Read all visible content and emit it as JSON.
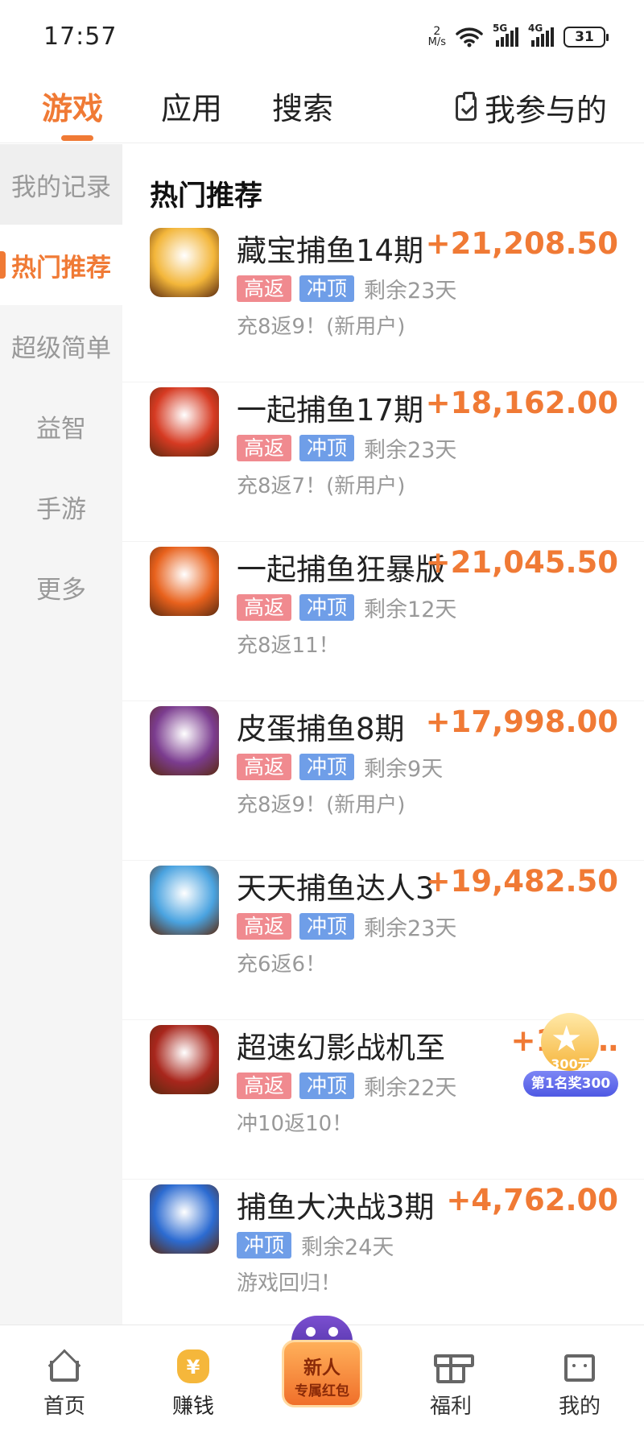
{
  "status_bar": {
    "time": "17:57",
    "net_speed_value": "2",
    "net_speed_unit": "M/s",
    "sim1": "5G",
    "sim2": "4G",
    "battery": "31"
  },
  "top_tabs": {
    "games": "游戏",
    "apps": "应用",
    "search": "搜索",
    "mine": "我参与的"
  },
  "sidebar": {
    "items": [
      {
        "label": "我的记录"
      },
      {
        "label": "热门推荐"
      },
      {
        "label": "超级简单"
      },
      {
        "label": "益智"
      },
      {
        "label": "手游"
      },
      {
        "label": "更多"
      }
    ],
    "active_index": 1
  },
  "main": {
    "section_title": "热门推荐",
    "games": [
      {
        "name": "藏宝捕鱼14期",
        "amount": "+21,208.50",
        "tag_high": "高返",
        "tag_top": "冲顶",
        "remaining": "剩余23天",
        "desc": "充8返9！(新用户)",
        "icon": "fish-game-icon",
        "color": "#f3b63a"
      },
      {
        "name": "一起捕鱼17期",
        "amount": "+18,162.00",
        "tag_high": "高返",
        "tag_top": "冲顶",
        "remaining": "剩余23天",
        "desc": "充8返7！(新用户)",
        "icon": "shark-game-icon",
        "color": "#d63a22"
      },
      {
        "name": "一起捕鱼狂暴版",
        "amount": "+21,045.50",
        "tag_high": "高返",
        "tag_top": "冲顶",
        "remaining": "剩余12天",
        "desc": "充8返11！",
        "icon": "dragon-game-icon",
        "color": "#e8611c"
      },
      {
        "name": "皮蛋捕鱼8期",
        "amount": "+17,998.00",
        "tag_high": "高返",
        "tag_top": "冲顶",
        "remaining": "剩余9天",
        "desc": "充8返9！(新用户)",
        "icon": "cannon-game-icon",
        "color": "#7b3c8f"
      },
      {
        "name": "天天捕鱼达人3",
        "amount": "+19,482.50",
        "tag_high": "高返",
        "tag_top": "冲顶",
        "remaining": "剩余23天",
        "desc": "充6返6！",
        "icon": "shark-coin-game-icon",
        "color": "#4aa3e0"
      },
      {
        "name": "超速幻影战机至",
        "amount": "+16,…",
        "tag_high": "高返",
        "tag_top": "冲顶",
        "remaining": "剩余22天",
        "desc": "冲10返10！",
        "icon": "fighter-jet-game-icon",
        "color": "#a8261c"
      },
      {
        "name": "捕鱼大决战3期",
        "amount": "+4,762.00",
        "tag_high": "",
        "tag_top": "冲顶",
        "remaining": "剩余24天",
        "desc": "游戏回归！",
        "icon": "blue-shark-game-icon",
        "color": "#2c6bd1"
      }
    ]
  },
  "floating_badge": {
    "sub_text": "300元",
    "banner": "第1名奖300"
  },
  "bottom_nav": {
    "home": "首页",
    "earn": "赚钱",
    "earn_icon_char": "¥",
    "promo_line1": "新人",
    "promo_line2": "专属红包",
    "welfare": "福利",
    "mine": "我的"
  },
  "colors": {
    "accent": "#f07a35",
    "tag_high": "#f08a8f",
    "tag_top": "#6f9ee8"
  }
}
